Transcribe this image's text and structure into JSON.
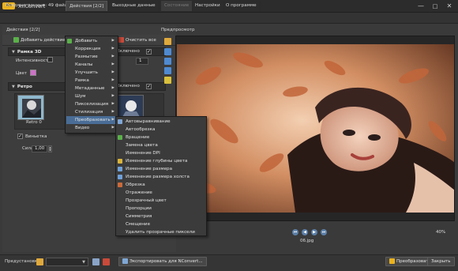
{
  "app": {
    "title": "XnConvert",
    "logo_text": "Xn",
    "window_controls": {
      "minimize": "—",
      "maximize": "□",
      "close": "✕"
    }
  },
  "tabs": [
    {
      "label": "Входные данные: 49 файлов"
    },
    {
      "label": "Действия [2/2]"
    },
    {
      "label": "Выходные данные"
    },
    {
      "label": "Состояние"
    },
    {
      "label": "Настройки"
    },
    {
      "label": "О программе"
    }
  ],
  "actions": {
    "header": "Действия [2/2]",
    "add_button": "Добавить действие>",
    "clear_button": "Очистить все"
  },
  "frame_section": {
    "title": "Рамка 3D",
    "enabled_label": "Включено",
    "intensity_label": "Интенсивность",
    "intensity_value": "1",
    "color_label": "Цвет",
    "color_value": "#d070c8"
  },
  "retro_section": {
    "title": "Ретро",
    "enabled_label": "Включено",
    "thumbs": [
      {
        "caption": "Retro 0"
      },
      {
        "caption": ""
      }
    ],
    "vignette_label": "Виньетка",
    "strength_label": "Сила",
    "strength_value": "1,00"
  },
  "preview": {
    "label": "Предпросмотр",
    "file_name": "06.jpg",
    "zoom": "40%"
  },
  "menu_main": {
    "items": [
      {
        "label": "Добавить",
        "icon": "plus-icon"
      },
      {
        "label": "Коррекция",
        "icon": ""
      },
      {
        "label": "Размытие",
        "icon": ""
      },
      {
        "label": "Каналы",
        "icon": ""
      },
      {
        "label": "Улучшить",
        "icon": ""
      },
      {
        "label": "Рамка",
        "icon": ""
      },
      {
        "label": "Метаданные",
        "icon": ""
      },
      {
        "label": "Шум",
        "icon": ""
      },
      {
        "label": "Пикселизация",
        "icon": ""
      },
      {
        "label": "Стилизация",
        "icon": ""
      },
      {
        "label": "Преобразовать",
        "icon": ""
      },
      {
        "label": "Видео",
        "icon": ""
      }
    ],
    "highlighted": "Преобразовать"
  },
  "menu_transform": {
    "items": [
      "Автовыравнивание",
      "Автообрезка",
      "Вращение",
      "Замена цвета",
      "Изменение DPI",
      "Изменение глубины цвета",
      "Изменение размера",
      "Изменение размера холста",
      "Обрезка",
      "Отражение",
      "Прозрачный цвет",
      "Пропорции",
      "Симметрия",
      "Смещение",
      "Удалить прозрачные пиксели"
    ]
  },
  "bottom": {
    "presets_label": "Предустановки:",
    "export_button": "Экспортировать для NConvert...",
    "convert_button": "Преобразовать",
    "close_button": "Закрыть"
  },
  "colors": {
    "accent": "#496d96",
    "window_bg": "#3a3a3a",
    "logo": "#e9b21f"
  }
}
